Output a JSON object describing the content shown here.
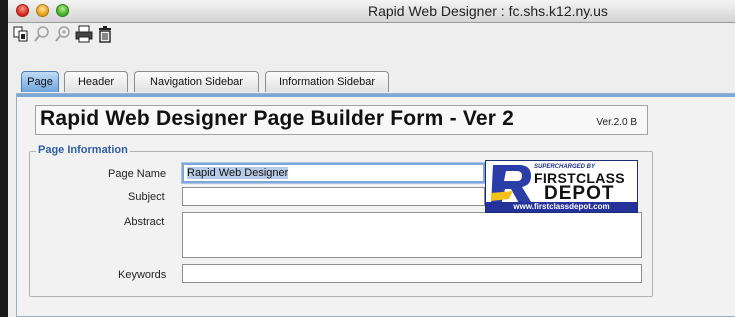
{
  "window": {
    "title": "Rapid Web Designer : fc.shs.k12.ny.us"
  },
  "toolbar": {
    "icons": [
      "copy-icon",
      "find-icon",
      "find-next-icon",
      "print-icon",
      "trash-icon"
    ]
  },
  "tabs": [
    {
      "label": "Page",
      "active": true
    },
    {
      "label": "Header"
    },
    {
      "label": "Navigation Sidebar"
    },
    {
      "label": "Information Sidebar"
    }
  ],
  "form": {
    "title": "Rapid Web Designer Page Builder Form - Ver 2",
    "version": "Ver.2.0 B",
    "section_title": "Page Information",
    "fields": {
      "page_name": {
        "label": "Page Name",
        "value": "Rapid Web Designer"
      },
      "subject": {
        "label": "Subject",
        "value": ""
      },
      "abstract": {
        "label": "Abstract",
        "value": ""
      },
      "keywords": {
        "label": "Keywords",
        "value": ""
      }
    }
  },
  "logo": {
    "tagline": "SUPERCHARGED BY",
    "line1": "FIRSTCLASS",
    "line2": "DEPOT",
    "url": "www.firstclassdepot.com"
  },
  "colors": {
    "accent": "#7da7d6",
    "active_tab": "#6fa5db",
    "logo_blue": "#25329a",
    "section_title": "#2f5fa0"
  }
}
